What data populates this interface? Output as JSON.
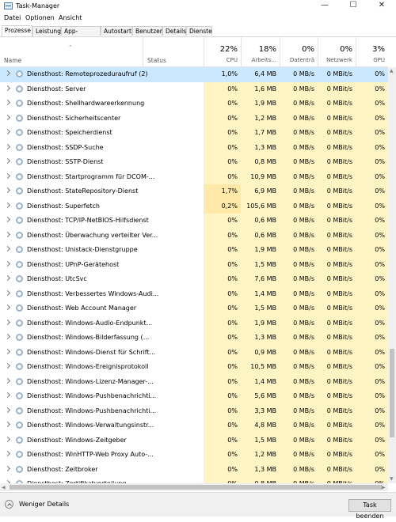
{
  "window": {
    "title": "Task-Manager",
    "minimize_glyph": "—",
    "maximize_glyph": "☐",
    "close_glyph": "✕"
  },
  "menu": [
    "Datei",
    "Optionen",
    "Ansicht"
  ],
  "tabs": [
    "Prozesse",
    "Leistung",
    "App-Verlauf",
    "Autostart",
    "Benutzer",
    "Details",
    "Dienste"
  ],
  "active_tab": "Prozesse",
  "columns": {
    "name": "Name",
    "status": "Status",
    "cpu": {
      "pct": "22%",
      "label": "CPU"
    },
    "memory": {
      "pct": "18%",
      "label": "Arbeits..."
    },
    "disk": {
      "pct": "0%",
      "label": "Datenträ"
    },
    "network": {
      "pct": "0%",
      "label": "Netzwerk"
    },
    "gpu": {
      "pct": "3%",
      "label": "GPU"
    }
  },
  "rows": [
    {
      "name": "Diensthost: Remoteprozeduraufruf (2)",
      "cpu": "1,0%",
      "mem": "6,4 MB",
      "disk": "0 MB/s",
      "net": "0 MBit/s",
      "gpu": "0%",
      "selected": true
    },
    {
      "name": "Diensthost: Server",
      "cpu": "0%",
      "mem": "1,6 MB",
      "disk": "0 MB/s",
      "net": "0 MBit/s",
      "gpu": "0%"
    },
    {
      "name": "Diensthost: Shellhardwareerkennung",
      "cpu": "0%",
      "mem": "1,9 MB",
      "disk": "0 MB/s",
      "net": "0 MBit/s",
      "gpu": "0%"
    },
    {
      "name": "Diensthost: Sicherheitscenter",
      "cpu": "0%",
      "mem": "1,2 MB",
      "disk": "0 MB/s",
      "net": "0 MBit/s",
      "gpu": "0%"
    },
    {
      "name": "Diensthost: Speicherdienst",
      "cpu": "0%",
      "mem": "1,7 MB",
      "disk": "0 MB/s",
      "net": "0 MBit/s",
      "gpu": "0%"
    },
    {
      "name": "Diensthost: SSDP-Suche",
      "cpu": "0%",
      "mem": "1,3 MB",
      "disk": "0 MB/s",
      "net": "0 MBit/s",
      "gpu": "0%"
    },
    {
      "name": "Diensthost: SSTP-Dienst",
      "cpu": "0%",
      "mem": "0,8 MB",
      "disk": "0 MB/s",
      "net": "0 MBit/s",
      "gpu": "0%"
    },
    {
      "name": "Diensthost: Startprogramm für DCOM-...",
      "cpu": "0%",
      "mem": "10,9 MB",
      "disk": "0 MB/s",
      "net": "0 MBit/s",
      "gpu": "0%"
    },
    {
      "name": "Diensthost: StateRepository-Dienst",
      "cpu": "1,7%",
      "mem": "6,9 MB",
      "disk": "0 MB/s",
      "net": "0 MBit/s",
      "gpu": "0%",
      "cpu_highlight": true
    },
    {
      "name": "Diensthost: Superfetch",
      "cpu": "0,2%",
      "mem": "105,6 MB",
      "disk": "0 MB/s",
      "net": "0 MBit/s",
      "gpu": "0%",
      "cpu_highlight": true
    },
    {
      "name": "Diensthost: TCP/IP-NetBIOS-Hilfsdienst",
      "cpu": "0%",
      "mem": "0,6 MB",
      "disk": "0 MB/s",
      "net": "0 MBit/s",
      "gpu": "0%"
    },
    {
      "name": "Diensthost: Überwachung verteilter Ver...",
      "cpu": "0%",
      "mem": "0,6 MB",
      "disk": "0 MB/s",
      "net": "0 MBit/s",
      "gpu": "0%"
    },
    {
      "name": "Diensthost: Unistack-Dienstgruppe",
      "cpu": "0%",
      "mem": "1,9 MB",
      "disk": "0 MB/s",
      "net": "0 MBit/s",
      "gpu": "0%"
    },
    {
      "name": "Diensthost: UPnP-Gerätehost",
      "cpu": "0%",
      "mem": "1,5 MB",
      "disk": "0 MB/s",
      "net": "0 MBit/s",
      "gpu": "0%"
    },
    {
      "name": "Diensthost: UtcSvc",
      "cpu": "0%",
      "mem": "7,6 MB",
      "disk": "0 MB/s",
      "net": "0 MBit/s",
      "gpu": "0%"
    },
    {
      "name": "Diensthost: Verbessertes Windows-Audi...",
      "cpu": "0%",
      "mem": "1,4 MB",
      "disk": "0 MB/s",
      "net": "0 MBit/s",
      "gpu": "0%"
    },
    {
      "name": "Diensthost: Web Account Manager",
      "cpu": "0%",
      "mem": "1,5 MB",
      "disk": "0 MB/s",
      "net": "0 MBit/s",
      "gpu": "0%"
    },
    {
      "name": "Diensthost: Windows-Audio-Endpunkt...",
      "cpu": "0%",
      "mem": "1,9 MB",
      "disk": "0 MB/s",
      "net": "0 MBit/s",
      "gpu": "0%"
    },
    {
      "name": "Diensthost: Windows-Bilderfassung (...",
      "cpu": "0%",
      "mem": "1,3 MB",
      "disk": "0 MB/s",
      "net": "0 MBit/s",
      "gpu": "0%"
    },
    {
      "name": "Diensthost: Windows-Dienst für Schrift...",
      "cpu": "0%",
      "mem": "0,9 MB",
      "disk": "0 MB/s",
      "net": "0 MBit/s",
      "gpu": "0%"
    },
    {
      "name": "Diensthost: Windows-Ereignisprotokoll",
      "cpu": "0%",
      "mem": "10,5 MB",
      "disk": "0 MB/s",
      "net": "0 MBit/s",
      "gpu": "0%"
    },
    {
      "name": "Diensthost: Windows-Lizenz-Manager-...",
      "cpu": "0%",
      "mem": "1,4 MB",
      "disk": "0 MB/s",
      "net": "0 MBit/s",
      "gpu": "0%"
    },
    {
      "name": "Diensthost: Windows-Pushbenachrichti...",
      "cpu": "0%",
      "mem": "5,6 MB",
      "disk": "0 MB/s",
      "net": "0 MBit/s",
      "gpu": "0%"
    },
    {
      "name": "Diensthost: Windows-Pushbenachrichti...",
      "cpu": "0%",
      "mem": "3,3 MB",
      "disk": "0 MB/s",
      "net": "0 MBit/s",
      "gpu": "0%"
    },
    {
      "name": "Diensthost: Windows-Verwaltungsinstr...",
      "cpu": "0%",
      "mem": "4,8 MB",
      "disk": "0 MB/s",
      "net": "0 MBit/s",
      "gpu": "0%"
    },
    {
      "name": "Diensthost: Windows-Zeitgeber",
      "cpu": "0%",
      "mem": "1,5 MB",
      "disk": "0 MB/s",
      "net": "0 MBit/s",
      "gpu": "0%"
    },
    {
      "name": "Diensthost: WinHTTP-Web Proxy Auto-...",
      "cpu": "0%",
      "mem": "1,2 MB",
      "disk": "0 MB/s",
      "net": "0 MBit/s",
      "gpu": "0%"
    },
    {
      "name": "Diensthost: Zeitbroker",
      "cpu": "0%",
      "mem": "1,3 MB",
      "disk": "0 MB/s",
      "net": "0 MBit/s",
      "gpu": "0%"
    },
    {
      "name": "Diensthost: Zertifikatverteilung",
      "cpu": "0%",
      "mem": "0,8 MB",
      "disk": "0 MB/s",
      "net": "0 MBit/s",
      "gpu": "0%"
    }
  ],
  "footer": {
    "fewer_details": "Weniger Details",
    "end_task": "Task beenden"
  },
  "colors": {
    "heat_light": "#fff4c4",
    "heat_medium": "#ffe9a8",
    "selected": "#cce8ff"
  }
}
